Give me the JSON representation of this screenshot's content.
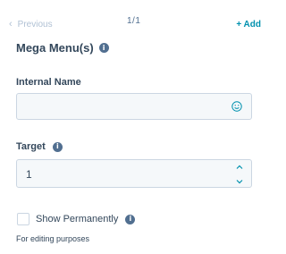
{
  "nav": {
    "previous_label": "Previous",
    "pager_text": "1/1",
    "add_label": "+ Add"
  },
  "section": {
    "title": "Mega Menu(s)"
  },
  "fields": {
    "internal_name": {
      "label": "Internal Name",
      "value": ""
    },
    "target": {
      "label": "Target",
      "value": "1"
    }
  },
  "checkbox": {
    "label": "Show Permanently",
    "checked": false
  },
  "help_text": "For editing purposes",
  "icons": {
    "info": "info-icon",
    "emoji": "emoji-icon",
    "previous": "chevron-left-icon",
    "stepper_up": "chevron-up-icon",
    "stepper_down": "chevron-down-icon"
  },
  "colors": {
    "accent": "#0091ae",
    "text": "#33475b",
    "muted": "#b0c1d4",
    "field_bg": "#f5f8fa",
    "border": "#cbd6e2"
  }
}
